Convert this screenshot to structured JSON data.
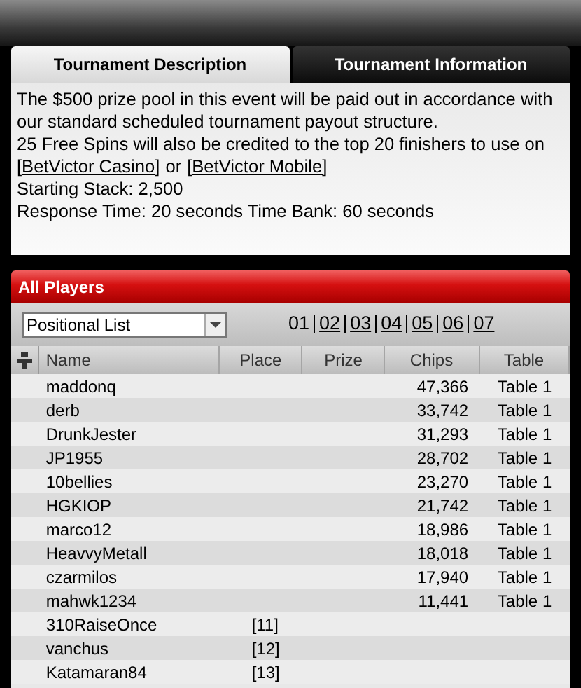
{
  "tabs": [
    {
      "label": "Tournament Description",
      "selected": true
    },
    {
      "label": "Tournament Information",
      "selected": false
    }
  ],
  "description": {
    "intro": "The $500 prize pool in this event will be paid out in accordance with our standard scheduled tournament payout structure.",
    "spins": "25 Free Spins will also be credited to the top 20 finishers to use on",
    "link_1": "[BetVictor Casino]",
    "joiner": "or",
    "link_2": "[BetVictor Mobile]",
    "stack": "Starting Stack: 2,500",
    "timing": "Response Time: 20 seconds Time Bank: 60 seconds"
  },
  "players_panel": {
    "title": "All Players",
    "list_select": {
      "value": "Positional List"
    },
    "pages": [
      {
        "label": "01",
        "selected": true
      },
      {
        "label": "02",
        "selected": false
      },
      {
        "label": "03",
        "selected": false
      },
      {
        "label": "04",
        "selected": false
      },
      {
        "label": "05",
        "selected": false
      },
      {
        "label": "06",
        "selected": false
      },
      {
        "label": "07",
        "selected": false
      }
    ],
    "table": {
      "columns": [
        "Name",
        "Place",
        "Prize",
        "Chips",
        "Table"
      ],
      "rows": [
        {
          "name": "maddonq",
          "place": "",
          "prize": "",
          "chips": "47,366",
          "table": "Table 1"
        },
        {
          "name": "derb",
          "place": "",
          "prize": "",
          "chips": "33,742",
          "table": "Table 1"
        },
        {
          "name": "DrunkJester",
          "place": "",
          "prize": "",
          "chips": "31,293",
          "table": "Table 1"
        },
        {
          "name": "JP1955",
          "place": "",
          "prize": "",
          "chips": "28,702",
          "table": "Table 1"
        },
        {
          "name": "10bellies",
          "place": "",
          "prize": "",
          "chips": "23,270",
          "table": "Table 1"
        },
        {
          "name": "HGKIOP",
          "place": "",
          "prize": "",
          "chips": "21,742",
          "table": "Table 1"
        },
        {
          "name": "marco12",
          "place": "",
          "prize": "",
          "chips": "18,986",
          "table": "Table 1"
        },
        {
          "name": "HeavvyMetall",
          "place": "",
          "prize": "",
          "chips": "18,018",
          "table": "Table 1"
        },
        {
          "name": "czarmilos",
          "place": "",
          "prize": "",
          "chips": "17,940",
          "table": "Table 1"
        },
        {
          "name": "mahwk1234",
          "place": "",
          "prize": "",
          "chips": "11,441",
          "table": "Table 1"
        },
        {
          "name": "310RaiseOnce",
          "place": "[11]",
          "prize": "",
          "chips": "",
          "table": ""
        },
        {
          "name": "vanchus",
          "place": "[12]",
          "prize": "",
          "chips": "",
          "table": ""
        },
        {
          "name": "Katamaran84",
          "place": "[13]",
          "prize": "",
          "chips": "",
          "table": ""
        }
      ]
    }
  }
}
